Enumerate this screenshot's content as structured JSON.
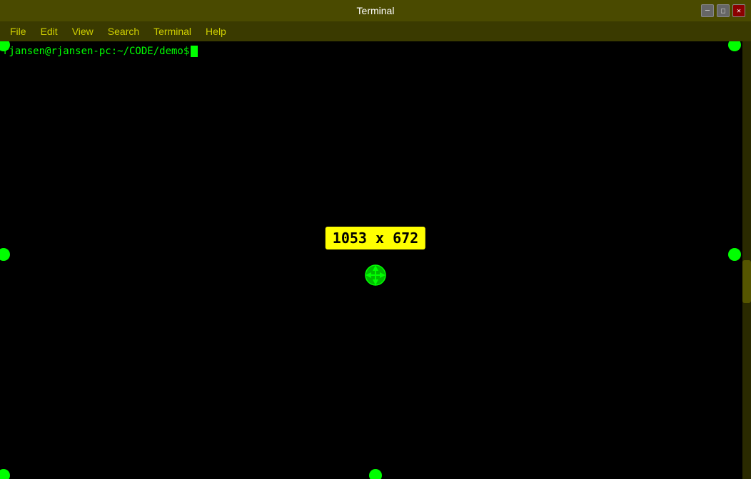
{
  "titleBar": {
    "title": "Terminal",
    "minimizeLabel": "─",
    "maximizeLabel": "□",
    "closeLabel": "✕"
  },
  "menuBar": {
    "items": [
      {
        "label": "File"
      },
      {
        "label": "Edit"
      },
      {
        "label": "View"
      },
      {
        "label": "Search"
      },
      {
        "label": "Terminal"
      },
      {
        "label": "Help"
      }
    ]
  },
  "terminal": {
    "prompt": "rjansen@rjansen-pc:~/CODE/demo$ "
  },
  "dimensionLabel": "1053 x 672",
  "colors": {
    "titleBarBg": "#4a4a00",
    "menuBarBg": "#3a3a00",
    "menuText": "#d0d000",
    "terminalBg": "#000000",
    "terminalText": "#00ff00",
    "dimensionBg": "#ffff00",
    "dimensionText": "#000000",
    "dotColor": "#00ff00"
  }
}
